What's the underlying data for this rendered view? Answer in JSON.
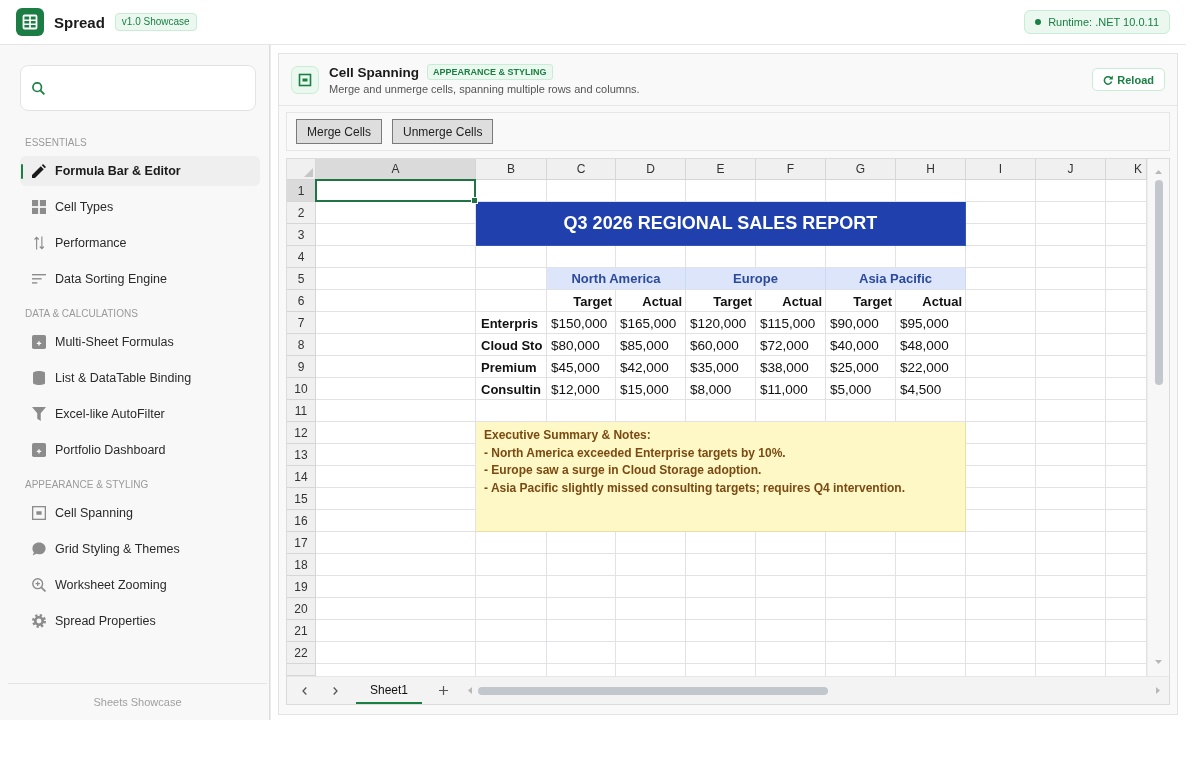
{
  "header": {
    "app_name": "Spread",
    "version_badge": "v1.0 Showcase",
    "runtime_status": "Runtime: .NET 10.0.11"
  },
  "sidebar": {
    "sections": [
      {
        "title": "ESSENTIALS",
        "items": [
          {
            "label": "Formula Bar & Editor",
            "selected": true
          },
          {
            "label": "Cell Types",
            "selected": false
          },
          {
            "label": "Performance",
            "selected": false
          },
          {
            "label": "Data Sorting Engine",
            "selected": false
          }
        ]
      },
      {
        "title": "DATA & CALCULATIONS",
        "items": [
          {
            "label": "Multi-Sheet Formulas",
            "selected": false
          },
          {
            "label": "List & DataTable Binding",
            "selected": false
          },
          {
            "label": "Excel-like AutoFilter",
            "selected": false
          },
          {
            "label": "Portfolio Dashboard",
            "selected": false
          }
        ]
      },
      {
        "title": "APPEARANCE & STYLING",
        "items": [
          {
            "label": "Cell Spanning",
            "selected": false
          },
          {
            "label": "Grid Styling & Themes",
            "selected": false
          },
          {
            "label": "Worksheet Zooming",
            "selected": false
          },
          {
            "label": "Spread Properties",
            "selected": false
          }
        ]
      }
    ],
    "footer": "Sheets Showcase"
  },
  "page": {
    "title": "Cell Spanning",
    "category_badge": "APPEARANCE & STYLING",
    "description": "Merge and unmerge cells, spanning multiple rows and columns.",
    "reload_button": "Reload"
  },
  "toolbar": {
    "buttons": [
      "Merge Cells",
      "Unmerge Cells"
    ]
  },
  "sheet": {
    "columns": [
      {
        "label": "A",
        "selected": true
      },
      {
        "label": "B",
        "selected": false
      },
      {
        "label": "C",
        "selected": false
      },
      {
        "label": "D",
        "selected": false
      },
      {
        "label": "E",
        "selected": false
      },
      {
        "label": "F",
        "selected": false
      },
      {
        "label": "G",
        "selected": false
      },
      {
        "label": "H",
        "selected": false
      },
      {
        "label": "I",
        "selected": false
      },
      {
        "label": "J",
        "selected": false
      },
      {
        "label": "K",
        "selected": false
      }
    ],
    "rows": [
      {
        "label": "1",
        "selected": true
      },
      {
        "label": "2",
        "selected": false,
        "cells": [
          null,
          {
            "kind": "title",
            "text": "Q3 2026 REGIONAL SALES REPORT"
          },
          {
            "kind": "merged"
          },
          {
            "kind": "merged"
          },
          {
            "kind": "merged"
          },
          {
            "kind": "merged"
          },
          {
            "kind": "merged"
          },
          {
            "kind": "merged"
          }
        ]
      },
      {
        "label": "3",
        "selected": false,
        "cells": [
          null,
          {
            "kind": "merged"
          },
          {
            "kind": "merged"
          },
          {
            "kind": "merged"
          },
          {
            "kind": "merged"
          },
          {
            "kind": "merged"
          },
          {
            "kind": "merged"
          },
          {
            "kind": "merged"
          }
        ]
      },
      {
        "label": "4",
        "selected": false
      },
      {
        "label": "5",
        "selected": false,
        "cells": [
          null,
          null,
          {
            "kind": "region",
            "text": "North America"
          },
          {
            "kind": "merged"
          },
          {
            "kind": "region",
            "text": "Europe"
          },
          {
            "kind": "merged"
          },
          {
            "kind": "region",
            "text": "Asia Pacific"
          },
          {
            "kind": "merged"
          }
        ]
      },
      {
        "label": "6",
        "selected": false,
        "cells": [
          null,
          null,
          {
            "kind": "header",
            "text": "Target"
          },
          {
            "kind": "header",
            "text": "Actual"
          },
          {
            "kind": "header",
            "text": "Target"
          },
          {
            "kind": "header",
            "text": "Actual"
          },
          {
            "kind": "header",
            "text": "Target"
          },
          {
            "kind": "header",
            "text": "Actual"
          }
        ]
      },
      {
        "label": "7",
        "selected": false,
        "cells": [
          null,
          {
            "kind": "label",
            "text": "Enterpris"
          },
          {
            "kind": "value",
            "text": "$150,000"
          },
          {
            "kind": "value",
            "text": "$165,000"
          },
          {
            "kind": "value",
            "text": "$120,000"
          },
          {
            "kind": "value",
            "text": "$115,000"
          },
          {
            "kind": "value",
            "text": "$90,000"
          },
          {
            "kind": "value",
            "text": "$95,000"
          }
        ]
      },
      {
        "label": "8",
        "selected": false,
        "cells": [
          null,
          {
            "kind": "label",
            "text": "Cloud Sto"
          },
          {
            "kind": "value",
            "text": "$80,000"
          },
          {
            "kind": "value",
            "text": "$85,000"
          },
          {
            "kind": "value",
            "text": "$60,000"
          },
          {
            "kind": "value",
            "text": "$72,000"
          },
          {
            "kind": "value",
            "text": "$40,000"
          },
          {
            "kind": "value",
            "text": "$48,000"
          }
        ]
      },
      {
        "label": "9",
        "selected": false,
        "cells": [
          null,
          {
            "kind": "label",
            "text": "Premium"
          },
          {
            "kind": "value",
            "text": "$45,000"
          },
          {
            "kind": "value",
            "text": "$42,000"
          },
          {
            "kind": "value",
            "text": "$35,000"
          },
          {
            "kind": "value",
            "text": "$38,000"
          },
          {
            "kind": "value",
            "text": "$25,000"
          },
          {
            "kind": "value",
            "text": "$22,000"
          }
        ]
      },
      {
        "label": "10",
        "selected": false,
        "cells": [
          null,
          {
            "kind": "label",
            "text": "Consultin"
          },
          {
            "kind": "value",
            "text": "$12,000"
          },
          {
            "kind": "value",
            "text": "$15,000"
          },
          {
            "kind": "value",
            "text": "$8,000"
          },
          {
            "kind": "value",
            "text": "$11,000"
          },
          {
            "kind": "value",
            "text": "$5,000"
          },
          {
            "kind": "value",
            "text": "$4,500"
          }
        ]
      },
      {
        "label": "11",
        "selected": false
      },
      {
        "label": "12",
        "selected": false,
        "cells": [
          null,
          {
            "kind": "note",
            "text": "Executive Summary & Notes:\n- North America exceeded Enterprise targets by 10%.\n- Europe saw a surge in Cloud Storage adoption.\n- Asia Pacific slightly missed consulting targets; requires Q4 intervention."
          },
          {
            "kind": "merged"
          },
          {
            "kind": "merged"
          },
          {
            "kind": "merged"
          },
          {
            "kind": "merged"
          },
          {
            "kind": "merged"
          },
          {
            "kind": "merged"
          }
        ]
      },
      {
        "label": "13",
        "selected": false,
        "cells": [
          null,
          {
            "kind": "merged"
          },
          {
            "kind": "merged"
          },
          {
            "kind": "merged"
          },
          {
            "kind": "merged"
          },
          {
            "kind": "merged"
          },
          {
            "kind": "merged"
          },
          {
            "kind": "merged"
          }
        ]
      },
      {
        "label": "14",
        "selected": false,
        "cells": [
          null,
          {
            "kind": "merged"
          },
          {
            "kind": "merged"
          },
          {
            "kind": "merged"
          },
          {
            "kind": "merged"
          },
          {
            "kind": "merged"
          },
          {
            "kind": "merged"
          },
          {
            "kind": "merged"
          }
        ]
      },
      {
        "label": "15",
        "selected": false,
        "cells": [
          null,
          {
            "kind": "merged"
          },
          {
            "kind": "merged"
          },
          {
            "kind": "merged"
          },
          {
            "kind": "merged"
          },
          {
            "kind": "merged"
          },
          {
            "kind": "merged"
          },
          {
            "kind": "merged"
          }
        ]
      },
      {
        "label": "16",
        "selected": false,
        "cells": [
          null,
          {
            "kind": "merged"
          },
          {
            "kind": "merged"
          },
          {
            "kind": "merged"
          },
          {
            "kind": "merged"
          },
          {
            "kind": "merged"
          },
          {
            "kind": "merged"
          },
          {
            "kind": "merged"
          }
        ]
      },
      {
        "label": "17",
        "selected": false
      },
      {
        "label": "18",
        "selected": false
      },
      {
        "label": "19",
        "selected": false
      },
      {
        "label": "20",
        "selected": false
      },
      {
        "label": "21",
        "selected": false
      },
      {
        "label": "22",
        "selected": false
      }
    ],
    "tabs": [
      {
        "label": "Sheet1",
        "selected": true
      }
    ]
  }
}
